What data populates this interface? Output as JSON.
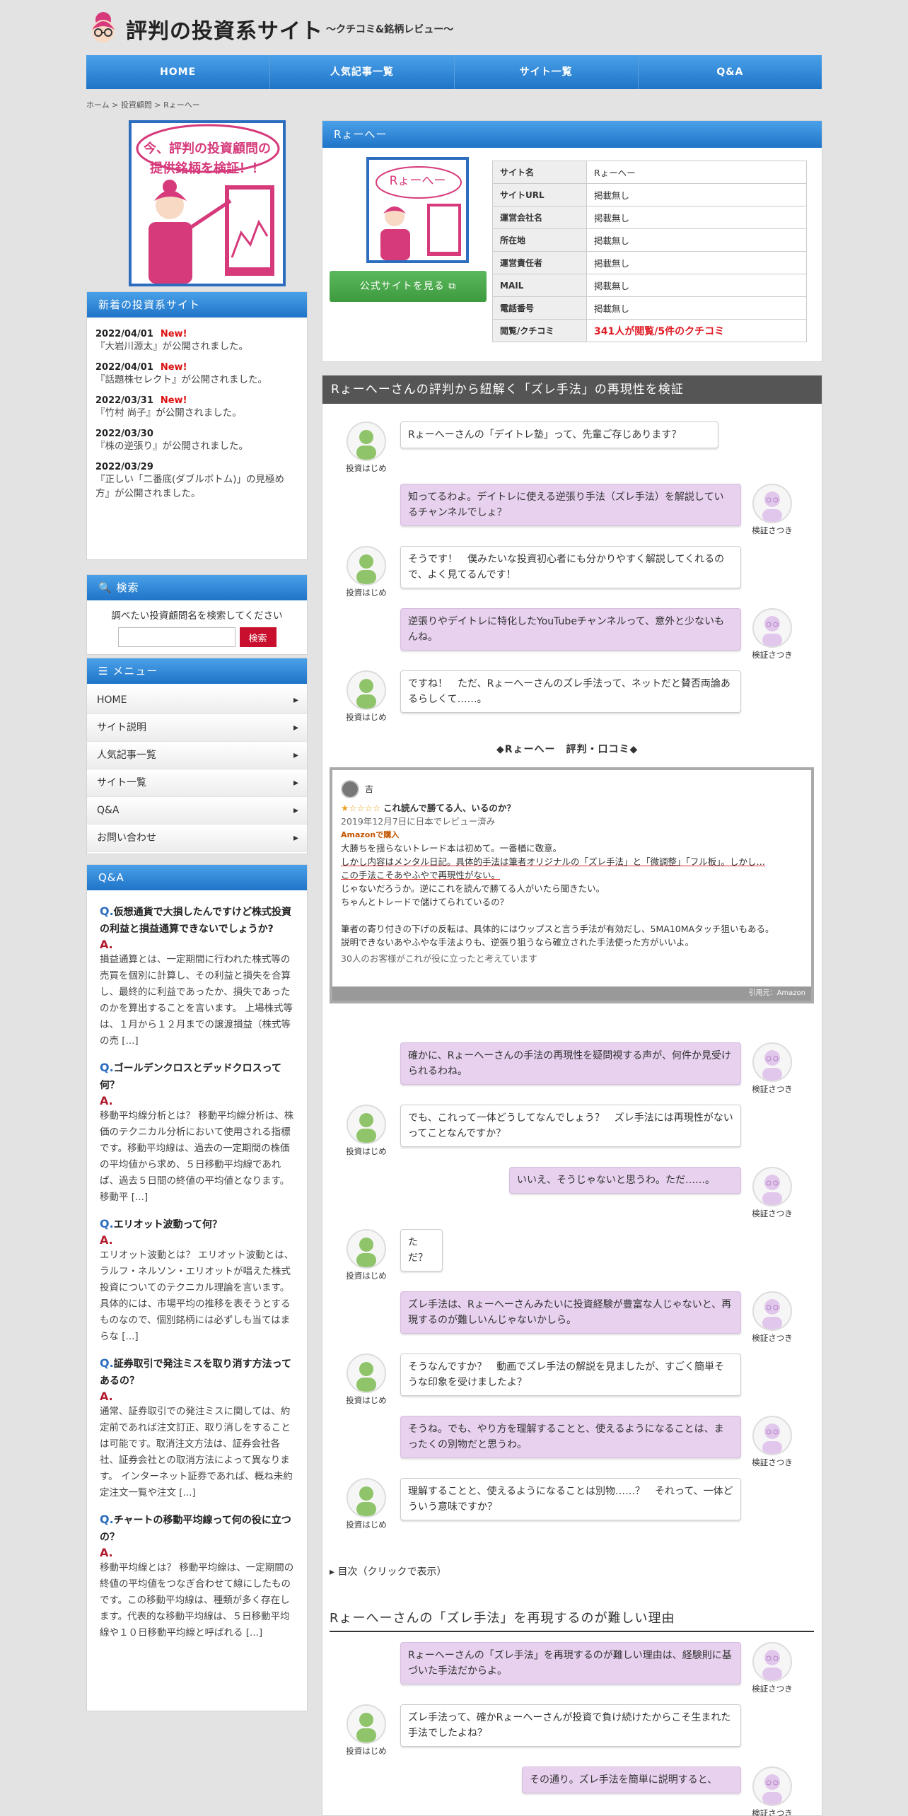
{
  "site": {
    "logo_main": "評判の投資系サイト",
    "logo_sub": "〜クチコミ&銘柄レビュー〜"
  },
  "nav": [
    "HOME",
    "人気記事一覧",
    "サイト一覧",
    "Q&A"
  ],
  "breadcrumb": "ホーム > 投資顧問 > Rょーへー",
  "banner": {
    "line1": "今、評判の投資顧問の",
    "line2": "提供銘柄を検証！！"
  },
  "news": {
    "title": "新着の投資系サイト",
    "items": [
      {
        "date": "2022/04/01",
        "new": "New!",
        "text": "『大岩川源太』が公開されました。"
      },
      {
        "date": "2022/04/01",
        "new": "New!",
        "text": "『話題株セレクト』が公開されました。"
      },
      {
        "date": "2022/03/31",
        "new": "New!",
        "text": "『竹村 尚子』が公開されました。"
      },
      {
        "date": "2022/03/30",
        "new": "",
        "text": "『株の逆張り』が公開されました。"
      },
      {
        "date": "2022/03/29",
        "new": "",
        "text": "『正しい「二番底(ダブルボトム)」の見極め方』が公開されました。"
      }
    ]
  },
  "search": {
    "title": "検索",
    "hint": "調べたい投資顧問名を検索してください",
    "button": "検索"
  },
  "menu": {
    "title": "メニュー",
    "items": [
      "HOME",
      "サイト説明",
      "人気記事一覧",
      "サイト一覧",
      "Q&A",
      "お問い合わせ"
    ]
  },
  "qa": {
    "title": "Q&A",
    "items": [
      {
        "q": "仮想通貨で大損したんですけど株式投資の利益と損益通算できないでしょうか?",
        "a": "損益通算とは、一定期間に行われた株式等の売買を個別に計算し、その利益と損失を合算し、最終的に利益であったか、損失であったのかを算出することを言います。 上場株式等は、１月から１２月までの譲渡損益（株式等の売 [...]"
      },
      {
        "q": "ゴールデンクロスとデッドクロスって何？",
        "a": "移動平均線分析とは？ 移動平均線分析は、株価のテクニカル分析において使用される指標です。移動平均線は、過去の一定期間の株価の平均値から求め、５日移動平均線であれば、過去５日間の終値の平均値となります。移動平 [...]"
      },
      {
        "q": "エリオット波動って何？",
        "a": "エリオット波動とは？ エリオット波動とは、ラルフ・ネルソン・エリオットが唱えた株式投資についてのテクニカル理論を言います。具体的には、市場平均の推移を表そうとするものなので、個別銘柄には必ずしも当てはまらな [...]"
      },
      {
        "q": "証券取引で発注ミスを取り消す方法ってあるの？",
        "a": "通常、証券取引での発注ミスに関しては、約定前であれば注文訂正、取り消しをすることは可能です。取消注文方法は、証券会社各社、証券会社との取消方法によって異なります。 インターネット証券であれば、概ね未約定注文一覧や注文 [...]"
      },
      {
        "q": "チャートの移動平均線って何の役に立つの？",
        "a": "移動平均線とは？ 移動平均線は、一定期間の終値の平均値をつなぎ合わせて線にしたものです。この移動平均線は、種類が多く存在します。代表的な移動平均線は、５日移動平均線や１０日移動平均線と呼ばれる [...]"
      }
    ]
  },
  "profile": {
    "title": "Rょーへー",
    "badge": "Rょーへー",
    "official": "公式サイトを見る",
    "rows": [
      {
        "k": "サイト名",
        "v": "Rょーへー"
      },
      {
        "k": "サイトURL",
        "v": "掲載無し"
      },
      {
        "k": "運営会社名",
        "v": "掲載無し"
      },
      {
        "k": "所在地",
        "v": "掲載無し"
      },
      {
        "k": "運営責任者",
        "v": "掲載無し"
      },
      {
        "k": "MAIL",
        "v": "掲載無し"
      },
      {
        "k": "電話番号",
        "v": "掲載無し"
      },
      {
        "k": "閲覧/クチコミ",
        "v": "341人が閲覧/5件のクチコミ"
      }
    ]
  },
  "section": {
    "title": "Rょーへーさんの評判から紐解く「ズレ手法」の再現性を検証"
  },
  "names": {
    "left": "投資はじめ",
    "right": "検証さつき"
  },
  "chat1": [
    "Rょーへーさんの「デイトレ塾」って、先輩ご存じあります？",
    "知ってるわよ。デイトレに使える逆張り手法（ズレ手法）を解説しているチャンネルでしょ？",
    "そうです！　僕みたいな投資初心者にも分かりやすく解説してくれるので、よく見てるんです！",
    "逆張りやデイトレに特化したYouTubeチャンネルって、意外と少ないもんね。",
    "ですね！　ただ、Rょーへーさんのズレ手法って、ネットだと賛否両論あるらしくて……。"
  ],
  "review": {
    "heading": "◆Rょーへー　評判・口コミ◆",
    "user": "吉",
    "stars": "★☆☆☆☆",
    "title": "これ読んで勝てる人、いるのか？",
    "date": "2019年12月7日に日本でレビュー済み",
    "tag": "Amazonで購入",
    "body": [
      "大勝ちを揺らないトレード本は初めて。一番楢に敬意。",
      "しかし内容はメンタル日記。具体的手法は筆者オリジナルの「ズレ手法」と「微調整」「フル板」。しかし…",
      "この手法こそあやふやで再現性がない。",
      "じゃないだろうか。逆にこれを読んで勝てる人がいたら聞きたい。",
      "ちゃんとトレードで儲けてられているの？",
      "",
      "筆者の寄り付きの下げの反転は、具体的にはウップスと言う手法が有効だし、5MA10MAタッチ狙いもある。",
      "説明できないあやふやな手法よりも、逆張り狙うなら確立された手法使った方がいいよ。"
    ],
    "helpful": "30人のお客様がこれが役に立ったと考えています",
    "source": "引用元：Amazon"
  },
  "chat2": [
    "確かに、Rょーへーさんの手法の再現性を疑問視する声が、何件か見受けられるわね。",
    "でも、これって一体どうしてなんでしょう？　ズレ手法には再現性がないってことなんですか？",
    "いいえ、そうじゃないと思うわ。ただ……。",
    "ただ？",
    "ズレ手法は、Rょーへーさんみたいに投資経験が豊富な人じゃないと、再現するのが難しいんじゃないかしら。",
    "そうなんですか？　動画でズレ手法の解説を見ましたが、すごく簡単そうな印象を受けましたよ？",
    "そうね。でも、やり方を理解することと、使えるようになることは、まったくの別物だと思うわ。",
    "理解することと、使えるようになることは別物……？　それって、一体どういう意味ですか？"
  ],
  "toc": "▸ 目次（クリックで表示）",
  "h2": "Rょーへーさんの「ズレ手法」を再現するのが難しい理由",
  "chat3": [
    "Rょーへーさんの「ズレ手法」を再現するのが難しい理由は、経験則に基づいた手法だからよ。",
    "ズレ手法って、確かRょーへーさんが投資で負け続けたからこそ生まれた手法でしたよね？",
    "その通り。ズレ手法を簡単に説明すると、"
  ]
}
